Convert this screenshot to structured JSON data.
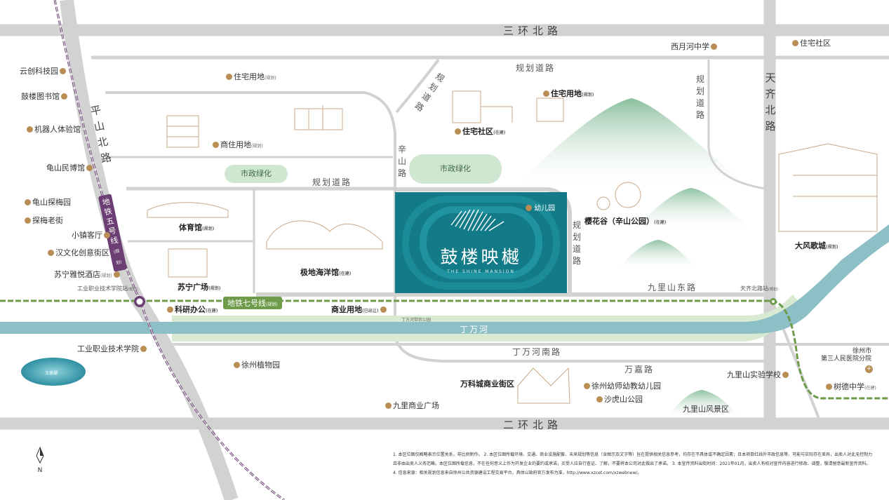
{
  "roads": {
    "ring3": "三环北路",
    "ring2": "二环北路",
    "pingshan": "平山北路",
    "tianqi": "天齐北路",
    "xinshan": "辛山路",
    "plan_top": "规划道路",
    "plan_diag": "规划道路",
    "plan_right": "规划道路",
    "plan_mid": "规划道路",
    "plan_project": "规划道路",
    "jiulishan_east": "九里山东路",
    "dingwanhe_south": "丁万河南路",
    "wanjia": "万嘉路",
    "river": "丁万河",
    "riverside_park": "丁万河带状公园"
  },
  "metro": {
    "line5": "地铁五号线",
    "line5_note": "(规划)",
    "line7": "地铁七号线",
    "line7_note": "(规划)",
    "station_west": "工业职业技术学院站",
    "station_west_note": "(规划)",
    "station_east": "天齐北路站",
    "station_east_note": "(规划)"
  },
  "project": {
    "name": "鼓楼映樾",
    "name_en": "THE SHINE MANSION",
    "kindergarten": "幼儿园"
  },
  "pois": {
    "yunchuang": "云创科技园",
    "library": "鼓楼图书馆",
    "robot": "机器人体验馆",
    "guishan_museum": "龟山民博馆",
    "guishan_tanmei": "龟山探梅园",
    "tanmei_street": "探梅老街",
    "xiaozhen": "小镇客厅",
    "hanwenhua": "汉文化创意街区",
    "suning_hotel": "苏宁雅悦酒店",
    "suning_hotel_note": "(规划)",
    "residential_1": "住宅用地",
    "residential_1_note": "(规划)",
    "commercial_res": "商住用地",
    "commercial_res_note": "(规划)",
    "green_1": "市政绿化",
    "green_2": "市政绿化",
    "gym": "体育馆",
    "gym_note": "(规划)",
    "polar": "极地海洋馆",
    "polar_note": "(在建)",
    "suning_plaza": "苏宁广场",
    "suning_plaza_note": "(规划)",
    "research": "科研办公",
    "research_note": "(在建)",
    "commercial_land": "商业用地",
    "commercial_land_note": "(已出让)",
    "residential_community": "住宅社区",
    "residential_community_note": "(在建)",
    "residential_2": "住宅用地",
    "residential_2_note": "(规划)",
    "ximeyue_school": "西月河中学",
    "zhuzhai_shequ": "住宅社区",
    "yinghuagu": "樱花谷（辛山公园）",
    "yinghuagu_note": "(在建)",
    "dafeng": "大风歌城",
    "dafeng_note": "(规划)",
    "gongye_college": "工业职业技术学院",
    "yuquan": "玉泉湖",
    "botanic": "徐州植物园",
    "jiuli_commercial": "九里商业广场",
    "vanke": "万科城商业街区",
    "kindergarten_xz": "徐州幼师幼教幼儿园",
    "shahushan": "沙虎山公园",
    "jiulishan_school": "九里山实验学校",
    "jiulishan_scenic": "九里山风景区",
    "hospital": "徐州市\n第三人民医院分院",
    "shude": "树德中学",
    "shude_note": "(在建)"
  },
  "compass": "N",
  "footnote": "1. 本区位图仅概略表示位置关系，非比例制作。 2. 本区位图所载环境、交通、商业设施配套、未来规划等信息（含图示及文字等）旨在提供相关信息参考，均存在不具体或不确定因素；且本项目红线外市政信息等，可能与实际存在差异，出卖人对此无控制力且非由出卖人义务范畴。本区位图所载信息，不在任何意义上作为开发企业的要约或承诺，买受人应自行查证、了解，不要将本公司对此做出了承诺。 3. 本宣传资料出街时间：2021年01月，出卖人有权对宣传内容进行修改、调整，敬请留意最新宣传资料。 4. 信息来源：相关规划信息来自徐州公共资源建设工程交易平台，具体以政府官方发布为准，http://www.xzcet.com/xzwebnew/。",
  "colors": {
    "road": "#d2d2d2",
    "project": "#137a87",
    "river": "#8dbfc6",
    "green": "#8fc49a",
    "metro5": "#6b3f73",
    "metro7": "#6d9b4a",
    "poi": "#b98e55"
  }
}
